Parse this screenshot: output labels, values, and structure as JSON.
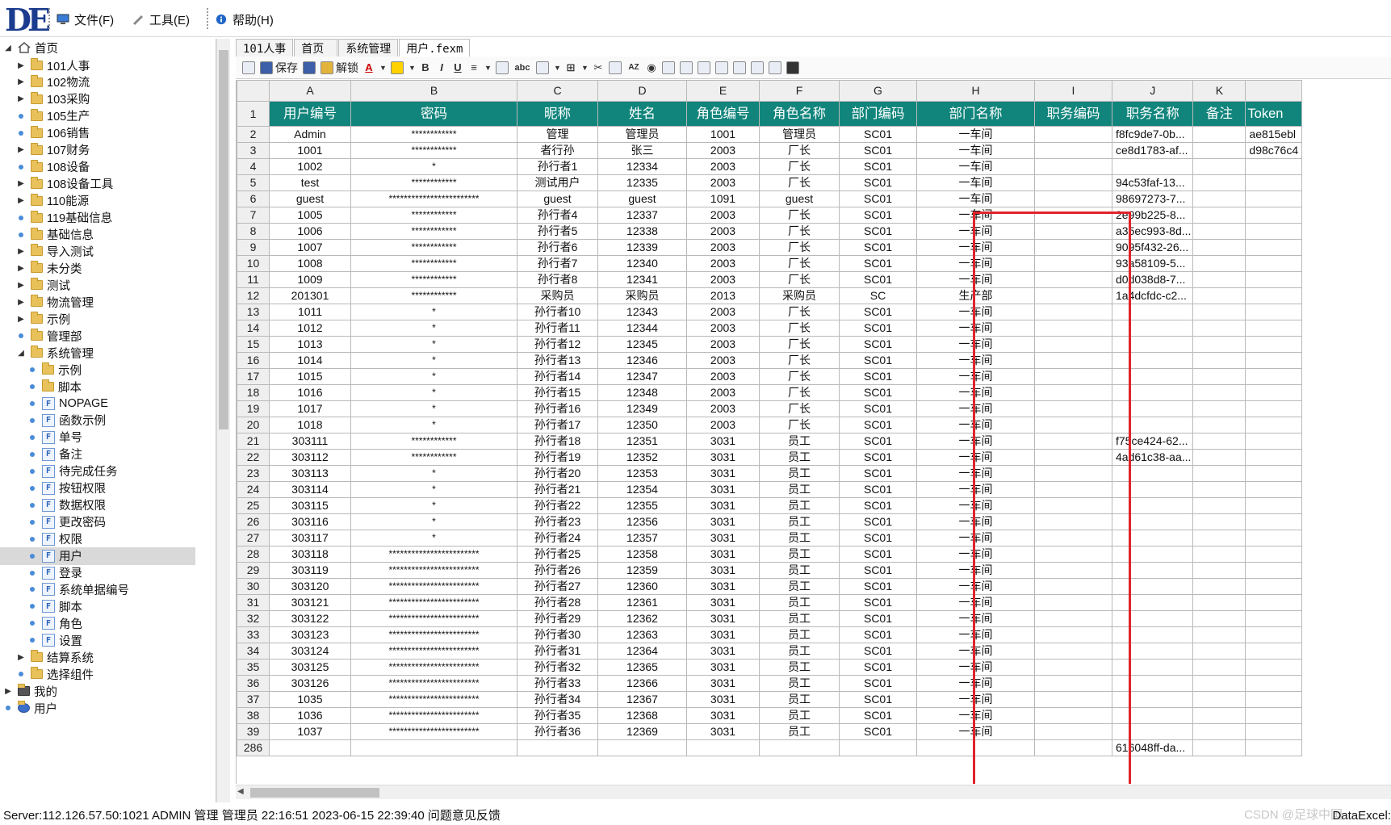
{
  "app": {
    "logo": "DE"
  },
  "menus": [
    {
      "label": "文件(F)",
      "icon": "computer-icon"
    },
    {
      "label": "工具(E)",
      "icon": "wrench-icon"
    },
    {
      "label": "帮助(H)",
      "icon": "info-icon"
    }
  ],
  "tree": {
    "root": "首页",
    "items": [
      {
        "label": "101人事",
        "kind": "folder",
        "level": 1,
        "arrow": "collapsed"
      },
      {
        "label": "102物流",
        "kind": "folder",
        "level": 1,
        "arrow": "collapsed"
      },
      {
        "label": "103采购",
        "kind": "folder",
        "level": 1,
        "arrow": "collapsed"
      },
      {
        "label": "105生产",
        "kind": "folder",
        "level": 1,
        "arrow": "dot"
      },
      {
        "label": "106销售",
        "kind": "folder",
        "level": 1,
        "arrow": "dot"
      },
      {
        "label": "107财务",
        "kind": "folder",
        "level": 1,
        "arrow": "collapsed"
      },
      {
        "label": "108设备",
        "kind": "folder",
        "level": 1,
        "arrow": "dot"
      },
      {
        "label": "108设备工具",
        "kind": "folder",
        "level": 1,
        "arrow": "collapsed"
      },
      {
        "label": "110能源",
        "kind": "folder",
        "level": 1,
        "arrow": "collapsed"
      },
      {
        "label": "119基础信息",
        "kind": "folder",
        "level": 1,
        "arrow": "dot"
      },
      {
        "label": "基础信息",
        "kind": "folder",
        "level": 1,
        "arrow": "dot"
      },
      {
        "label": "导入测试",
        "kind": "folder",
        "level": 1,
        "arrow": "collapsed"
      },
      {
        "label": "未分类",
        "kind": "folder",
        "level": 1,
        "arrow": "collapsed"
      },
      {
        "label": "测试",
        "kind": "folder",
        "level": 1,
        "arrow": "collapsed"
      },
      {
        "label": "物流管理",
        "kind": "folder",
        "level": 1,
        "arrow": "collapsed"
      },
      {
        "label": "示例",
        "kind": "folder",
        "level": 1,
        "arrow": "collapsed"
      },
      {
        "label": "管理部",
        "kind": "folder",
        "level": 1,
        "arrow": "dot"
      },
      {
        "label": "系统管理",
        "kind": "folder",
        "level": 1,
        "arrow": "expanded"
      },
      {
        "label": "示例",
        "kind": "folder",
        "level": 2,
        "arrow": "dot"
      },
      {
        "label": "脚本",
        "kind": "folder",
        "level": 2,
        "arrow": "dot"
      },
      {
        "label": "NOPAGE",
        "kind": "file",
        "level": 2,
        "arrow": "dot"
      },
      {
        "label": "函数示例",
        "kind": "file",
        "level": 2,
        "arrow": "dot"
      },
      {
        "label": "单号",
        "kind": "file",
        "level": 2,
        "arrow": "dot"
      },
      {
        "label": "备注",
        "kind": "file",
        "level": 2,
        "arrow": "dot"
      },
      {
        "label": "待完成任务",
        "kind": "file",
        "level": 2,
        "arrow": "dot"
      },
      {
        "label": "按钮权限",
        "kind": "file",
        "level": 2,
        "arrow": "dot"
      },
      {
        "label": "数据权限",
        "kind": "file",
        "level": 2,
        "arrow": "dot"
      },
      {
        "label": "更改密码",
        "kind": "file",
        "level": 2,
        "arrow": "dot"
      },
      {
        "label": "权限",
        "kind": "file",
        "level": 2,
        "arrow": "dot"
      },
      {
        "label": "用户",
        "kind": "file",
        "level": 2,
        "arrow": "dot",
        "selected": true
      },
      {
        "label": "登录",
        "kind": "file",
        "level": 2,
        "arrow": "dot"
      },
      {
        "label": "系统单据编号",
        "kind": "file",
        "level": 2,
        "arrow": "dot"
      },
      {
        "label": "脚本",
        "kind": "file",
        "level": 2,
        "arrow": "dot"
      },
      {
        "label": "角色",
        "kind": "file",
        "level": 2,
        "arrow": "dot"
      },
      {
        "label": "设置",
        "kind": "file",
        "level": 2,
        "arrow": "dot"
      },
      {
        "label": "结算系统",
        "kind": "folder",
        "level": 1,
        "arrow": "collapsed"
      },
      {
        "label": "选择组件",
        "kind": "folder",
        "level": 1,
        "arrow": "dot"
      },
      {
        "label": "我的",
        "kind": "monitor",
        "level": 0,
        "arrow": "collapsed"
      },
      {
        "label": "用户",
        "kind": "users",
        "level": 0,
        "arrow": "dot"
      }
    ]
  },
  "tabs": [
    "101人事",
    "首页",
    "系统管理",
    "用户.fexm"
  ],
  "toolbar": {
    "save": "保存",
    "unlock": "解锁",
    "abc": "abc",
    "bold": "B",
    "italic": "I",
    "underline": "U",
    "sort": "AZ"
  },
  "grid": {
    "col_letters": [
      "A",
      "B",
      "C",
      "D",
      "E",
      "F",
      "G",
      "H",
      "I",
      "J",
      "K",
      ""
    ],
    "headers": [
      "用户编号",
      "密码",
      "昵称",
      "姓名",
      "角色编号",
      "角色名称",
      "部门编码",
      "部门名称",
      "职务编码",
      "职务名称",
      "备注",
      "Token"
    ],
    "rows": [
      {
        "n": "2",
        "c": [
          "Admin",
          "************",
          "管理",
          "管理员",
          "1001",
          "管理员",
          "SC01",
          "一车间",
          "",
          "f8fc9de7-0b...",
          "",
          "ae815ebl"
        ]
      },
      {
        "n": "3",
        "c": [
          "1001",
          "************",
          "者行孙",
          "张三",
          "2003",
          "厂长",
          "SC01",
          "一车间",
          "",
          "ce8d1783-af...",
          "",
          "d98c76c4"
        ]
      },
      {
        "n": "4",
        "c": [
          "1002",
          "*",
          "孙行者1",
          "12334",
          "2003",
          "厂长",
          "SC01",
          "一车间",
          "",
          "",
          "",
          ""
        ]
      },
      {
        "n": "5",
        "c": [
          "test",
          "************",
          "测试用户",
          "12335",
          "2003",
          "厂长",
          "SC01",
          "一车间",
          "",
          "94c53faf-13...",
          "",
          ""
        ]
      },
      {
        "n": "6",
        "c": [
          "guest",
          "************************",
          "guest",
          "guest",
          "1091",
          "guest",
          "SC01",
          "一车间",
          "",
          "98697273-7...",
          "",
          ""
        ]
      },
      {
        "n": "7",
        "c": [
          "1005",
          "************",
          "孙行者4",
          "12337",
          "2003",
          "厂长",
          "SC01",
          "一车间",
          "",
          "2e99b225-8...",
          "",
          ""
        ]
      },
      {
        "n": "8",
        "c": [
          "1006",
          "************",
          "孙行者5",
          "12338",
          "2003",
          "厂长",
          "SC01",
          "一车间",
          "",
          "a35ec993-8d...",
          "",
          ""
        ]
      },
      {
        "n": "9",
        "c": [
          "1007",
          "************",
          "孙行者6",
          "12339",
          "2003",
          "厂长",
          "SC01",
          "一车间",
          "",
          "9095f432-26...",
          "",
          ""
        ]
      },
      {
        "n": "10",
        "c": [
          "1008",
          "************",
          "孙行者7",
          "12340",
          "2003",
          "厂长",
          "SC01",
          "一车间",
          "",
          "93a58109-5...",
          "",
          ""
        ]
      },
      {
        "n": "11",
        "c": [
          "1009",
          "************",
          "孙行者8",
          "12341",
          "2003",
          "厂长",
          "SC01",
          "一车间",
          "",
          "d0d038d8-7...",
          "",
          ""
        ]
      },
      {
        "n": "12",
        "c": [
          "201301",
          "************",
          "采购员",
          "采购员",
          "2013",
          "采购员",
          "SC",
          "生产部",
          "",
          "1a4dcfdc-c2...",
          "",
          ""
        ]
      },
      {
        "n": "13",
        "c": [
          "1011",
          "*",
          "孙行者10",
          "12343",
          "2003",
          "厂长",
          "SC01",
          "一车间",
          "",
          "",
          "",
          ""
        ]
      },
      {
        "n": "14",
        "c": [
          "1012",
          "*",
          "孙行者11",
          "12344",
          "2003",
          "厂长",
          "SC01",
          "一车间",
          "",
          "",
          "",
          ""
        ]
      },
      {
        "n": "15",
        "c": [
          "1013",
          "*",
          "孙行者12",
          "12345",
          "2003",
          "厂长",
          "SC01",
          "一车间",
          "",
          "",
          "",
          ""
        ]
      },
      {
        "n": "16",
        "c": [
          "1014",
          "*",
          "孙行者13",
          "12346",
          "2003",
          "厂长",
          "SC01",
          "一车间",
          "",
          "",
          "",
          ""
        ]
      },
      {
        "n": "17",
        "c": [
          "1015",
          "*",
          "孙行者14",
          "12347",
          "2003",
          "厂长",
          "SC01",
          "一车间",
          "",
          "",
          "",
          ""
        ]
      },
      {
        "n": "18",
        "c": [
          "1016",
          "*",
          "孙行者15",
          "12348",
          "2003",
          "厂长",
          "SC01",
          "一车间",
          "",
          "",
          "",
          ""
        ]
      },
      {
        "n": "19",
        "c": [
          "1017",
          "*",
          "孙行者16",
          "12349",
          "2003",
          "厂长",
          "SC01",
          "一车间",
          "",
          "",
          "",
          ""
        ]
      },
      {
        "n": "20",
        "c": [
          "1018",
          "*",
          "孙行者17",
          "12350",
          "2003",
          "厂长",
          "SC01",
          "一车间",
          "",
          "",
          "",
          ""
        ]
      },
      {
        "n": "21",
        "c": [
          "303111",
          "************",
          "孙行者18",
          "12351",
          "3031",
          "员工",
          "SC01",
          "一车间",
          "",
          "f75ce424-62...",
          "",
          ""
        ]
      },
      {
        "n": "22",
        "c": [
          "303112",
          "************",
          "孙行者19",
          "12352",
          "3031",
          "员工",
          "SC01",
          "一车间",
          "",
          "4ad61c38-aa...",
          "",
          ""
        ]
      },
      {
        "n": "23",
        "c": [
          "303113",
          "*",
          "孙行者20",
          "12353",
          "3031",
          "员工",
          "SC01",
          "一车间",
          "",
          "",
          "",
          ""
        ]
      },
      {
        "n": "24",
        "c": [
          "303114",
          "*",
          "孙行者21",
          "12354",
          "3031",
          "员工",
          "SC01",
          "一车间",
          "",
          "",
          "",
          ""
        ]
      },
      {
        "n": "25",
        "c": [
          "303115",
          "*",
          "孙行者22",
          "12355",
          "3031",
          "员工",
          "SC01",
          "一车间",
          "",
          "",
          "",
          ""
        ]
      },
      {
        "n": "26",
        "c": [
          "303116",
          "*",
          "孙行者23",
          "12356",
          "3031",
          "员工",
          "SC01",
          "一车间",
          "",
          "",
          "",
          ""
        ]
      },
      {
        "n": "27",
        "c": [
          "303117",
          "*",
          "孙行者24",
          "12357",
          "3031",
          "员工",
          "SC01",
          "一车间",
          "",
          "",
          "",
          ""
        ]
      },
      {
        "n": "28",
        "c": [
          "303118",
          "************************",
          "孙行者25",
          "12358",
          "3031",
          "员工",
          "SC01",
          "一车间",
          "",
          "",
          "",
          ""
        ]
      },
      {
        "n": "29",
        "c": [
          "303119",
          "************************",
          "孙行者26",
          "12359",
          "3031",
          "员工",
          "SC01",
          "一车间",
          "",
          "",
          "",
          ""
        ]
      },
      {
        "n": "30",
        "c": [
          "303120",
          "************************",
          "孙行者27",
          "12360",
          "3031",
          "员工",
          "SC01",
          "一车间",
          "",
          "",
          "",
          ""
        ]
      },
      {
        "n": "31",
        "c": [
          "303121",
          "************************",
          "孙行者28",
          "12361",
          "3031",
          "员工",
          "SC01",
          "一车间",
          "",
          "",
          "",
          ""
        ]
      },
      {
        "n": "32",
        "c": [
          "303122",
          "************************",
          "孙行者29",
          "12362",
          "3031",
          "员工",
          "SC01",
          "一车间",
          "",
          "",
          "",
          ""
        ]
      },
      {
        "n": "33",
        "c": [
          "303123",
          "************************",
          "孙行者30",
          "12363",
          "3031",
          "员工",
          "SC01",
          "一车间",
          "",
          "",
          "",
          ""
        ]
      },
      {
        "n": "34",
        "c": [
          "303124",
          "************************",
          "孙行者31",
          "12364",
          "3031",
          "员工",
          "SC01",
          "一车间",
          "",
          "",
          "",
          ""
        ]
      },
      {
        "n": "35",
        "c": [
          "303125",
          "************************",
          "孙行者32",
          "12365",
          "3031",
          "员工",
          "SC01",
          "一车间",
          "",
          "",
          "",
          ""
        ]
      },
      {
        "n": "36",
        "c": [
          "303126",
          "************************",
          "孙行者33",
          "12366",
          "3031",
          "员工",
          "SC01",
          "一车间",
          "",
          "",
          "",
          ""
        ]
      },
      {
        "n": "37",
        "c": [
          "1035",
          "************************",
          "孙行者34",
          "12367",
          "3031",
          "员工",
          "SC01",
          "一车间",
          "",
          "",
          "",
          ""
        ]
      },
      {
        "n": "38",
        "c": [
          "1036",
          "************************",
          "孙行者35",
          "12368",
          "3031",
          "员工",
          "SC01",
          "一车间",
          "",
          "",
          "",
          ""
        ]
      },
      {
        "n": "39",
        "c": [
          "1037",
          "************************",
          "孙行者36",
          "12369",
          "3031",
          "员工",
          "SC01",
          "一车间",
          "",
          "",
          "",
          ""
        ]
      },
      {
        "n": "286",
        "c": [
          "",
          "",
          "",
          "",
          "",
          "",
          "",
          "",
          "",
          "616048ff-da...",
          "",
          ""
        ]
      }
    ]
  },
  "status": {
    "text": "Server:112.126.57.50:1021  ADMIN 管理 管理员 22:16:51 2023-06-15 22:39:40  问题意见反馈",
    "watermark": "CSDN @足球中国",
    "dataexcel": "DataExcel:"
  },
  "colors": {
    "header_bg": "#11857c",
    "highlight": "#e0242a"
  }
}
